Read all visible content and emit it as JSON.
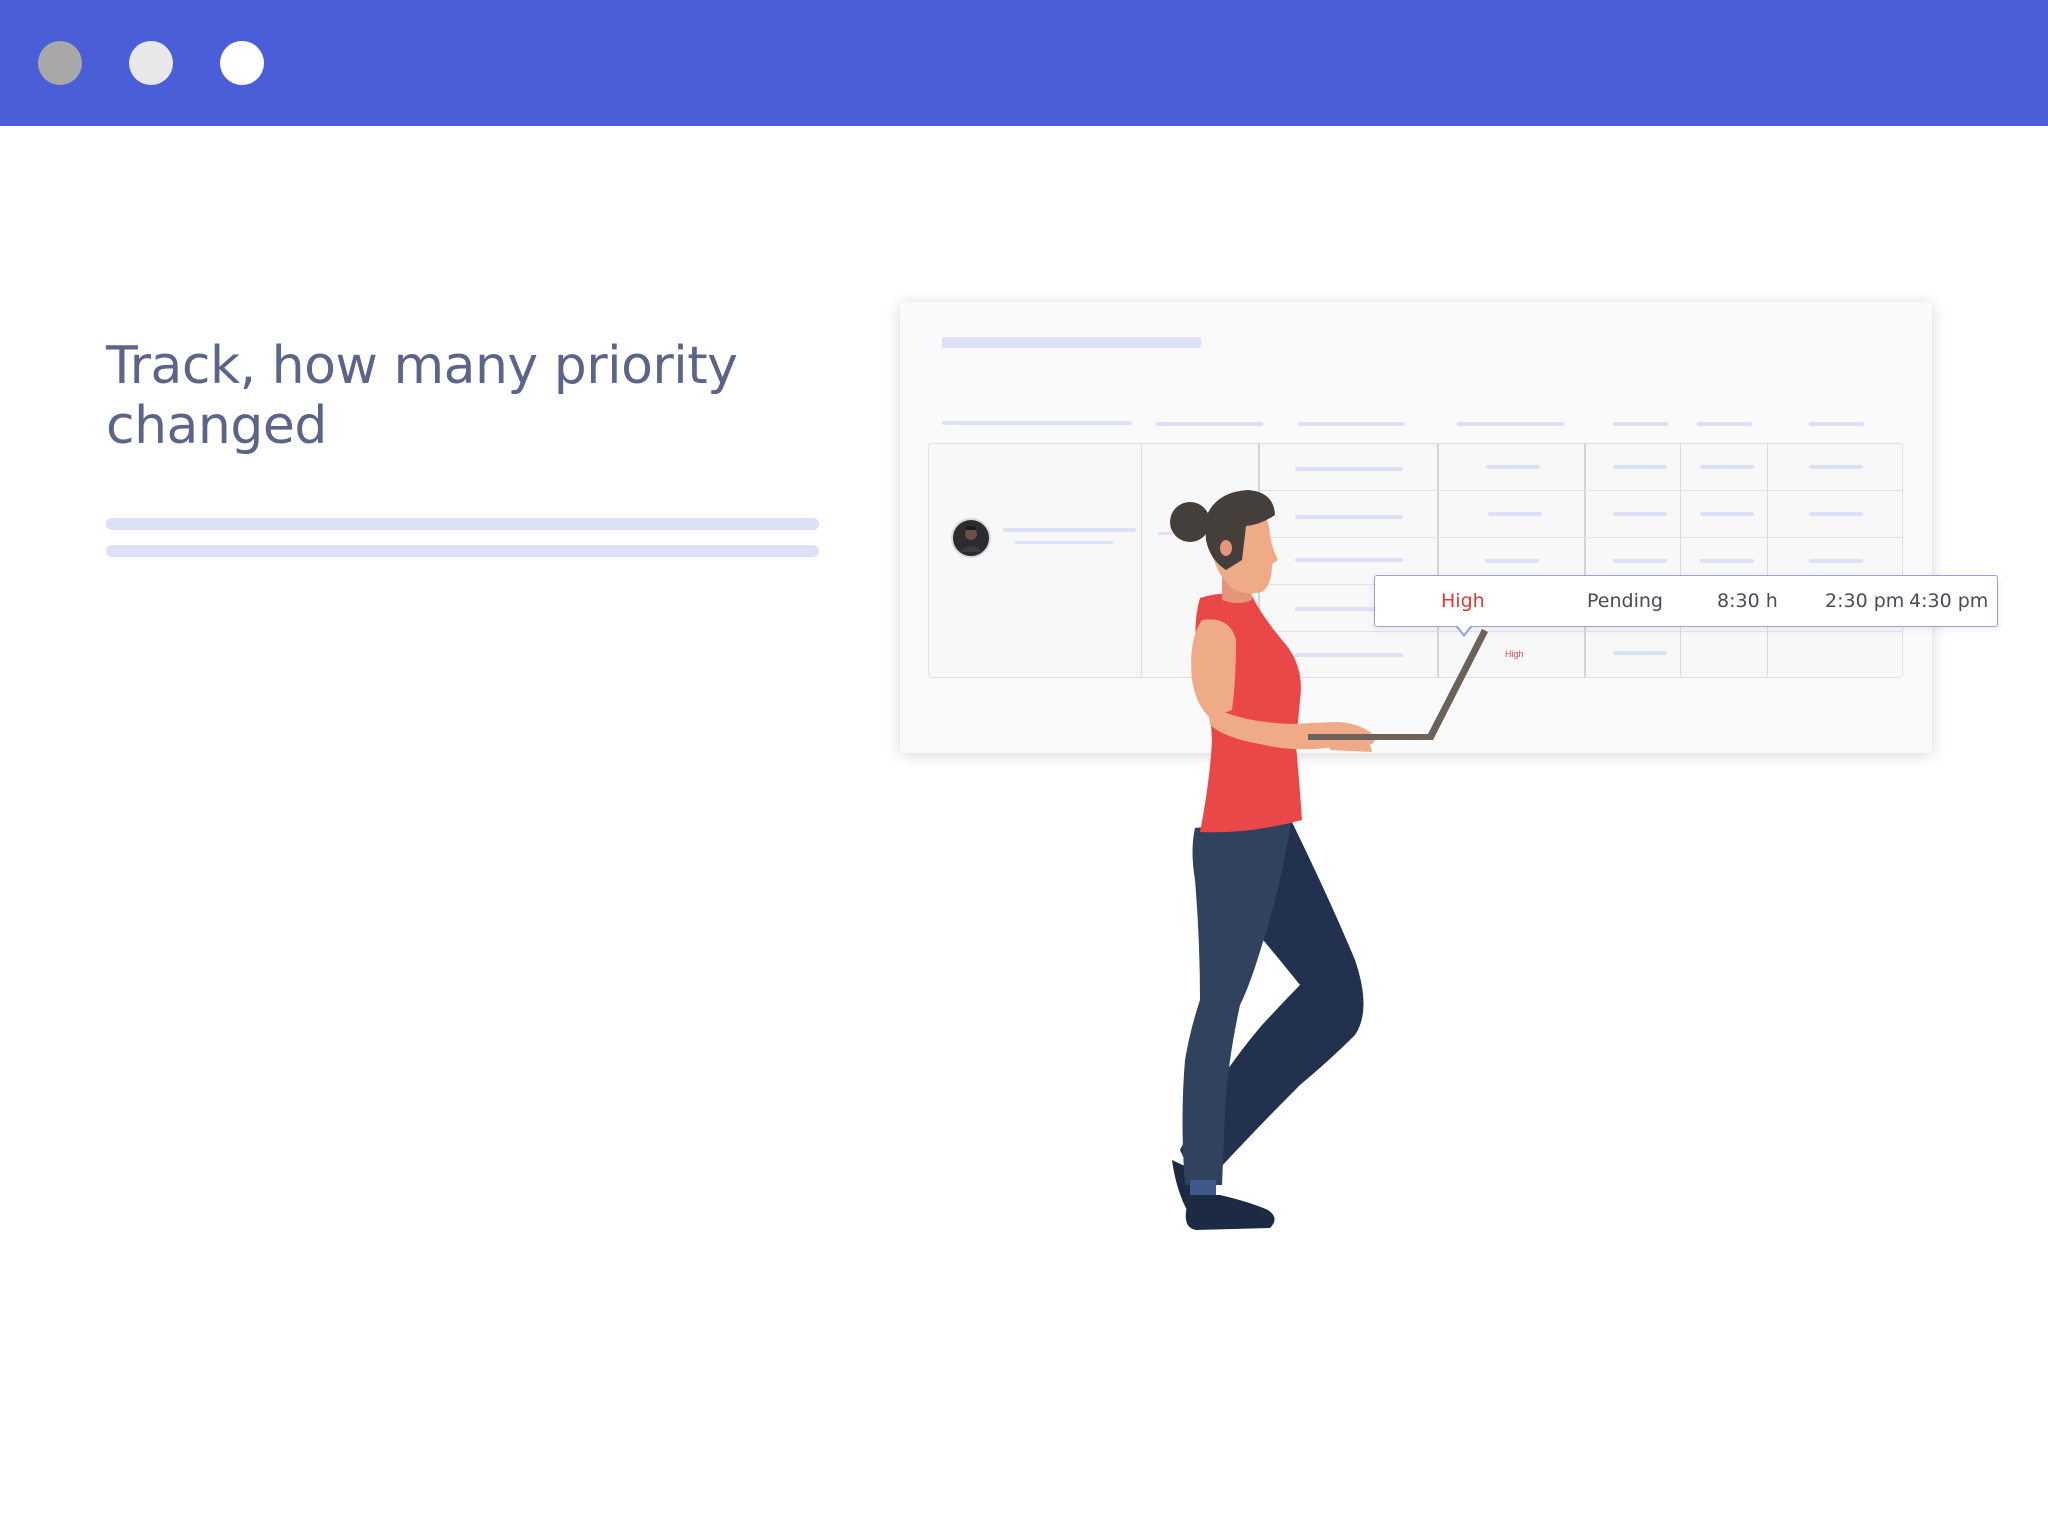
{
  "window": {
    "controls": [
      "close",
      "minimize",
      "maximize"
    ],
    "titlebar_color": "#4a5ed8"
  },
  "hero": {
    "headline": "Track, how many priority changed"
  },
  "table_preview": {
    "faint_row_priority": "High"
  },
  "tooltip": {
    "priority": "High",
    "status": "Pending",
    "duration": "8:30 h",
    "start_time": "2:30 pm",
    "end_time": "4:30 pm"
  },
  "colors": {
    "accent": "#4a5ed8",
    "headline": "#5a6589",
    "priority_high": "#d63b36",
    "placeholder": "#dde1f7"
  },
  "icons": [
    "avatar",
    "woman-with-laptop-illustration"
  ]
}
